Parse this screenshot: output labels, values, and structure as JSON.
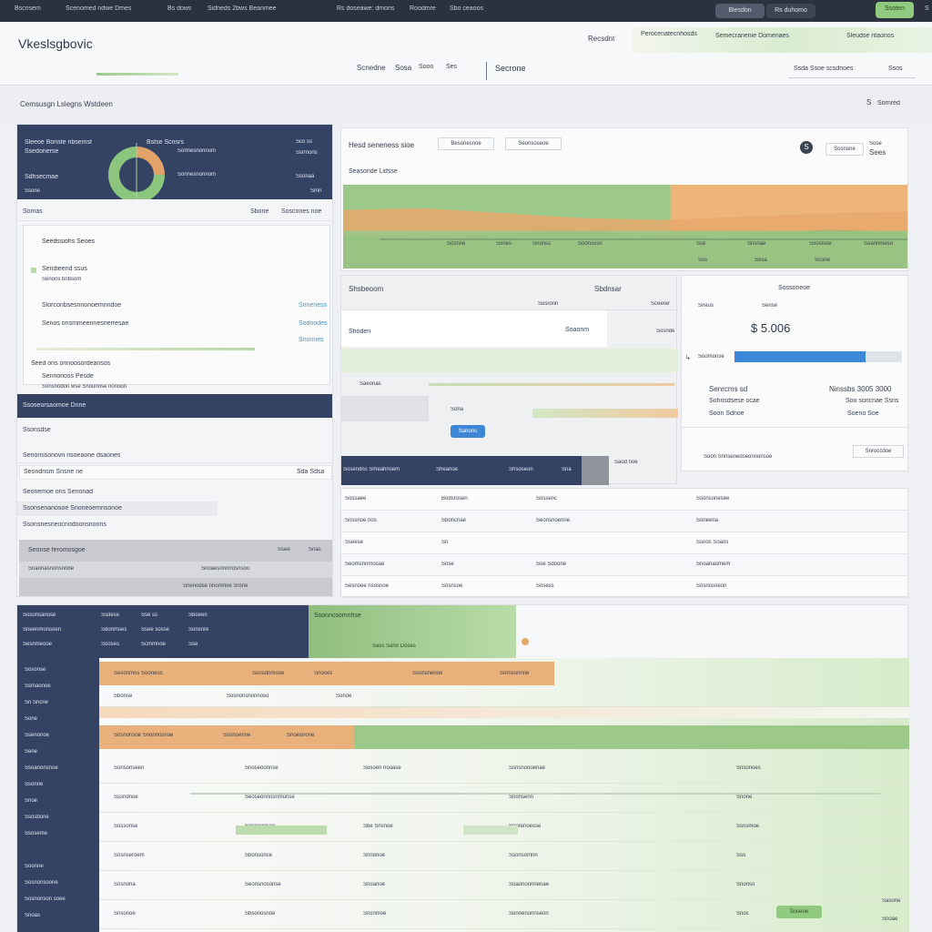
{
  "topbar": {
    "menu": [
      "Bscnsem",
      "Scenomed ndwe Dmes",
      "Bs dows",
      "Sidneds 2bws Beanmee",
      "Rs doseawe: dmons",
      "Roodmre",
      "Sbo ceaoos"
    ],
    "search_btn": "Blesdon",
    "filter_btn": "Rs duhomo",
    "action_btn": "Ssoten",
    "tail_icon": "S"
  },
  "header": {
    "title": "Vkeslsgbovic",
    "links": [
      "Recsdnt",
      "Perocenatecnhosds",
      "Semecranenie Domenaes",
      "Sleudse ntaonos"
    ],
    "tabs": [
      "Scnedne",
      "Sosa",
      "Sooo",
      "Ses"
    ],
    "active_tab": "Secrone",
    "right_tab": "Ssda Ssoe scsdnoes",
    "right_tab2": "Ssos"
  },
  "subnav": {
    "left": "Cemsusgn Lslegns Wstdeen",
    "right_icon": "S",
    "right": "Sornred"
  },
  "left_panel": {
    "navy_card": {
      "title": "Sleeoe Bonste nbsemst",
      "sub": "Ssedonerse",
      "label": "Sdhsecmae",
      "foot": "Ssone",
      "mid_title": "Bstse Scnsrs",
      "mid_sub": "Sorlnesnonnom",
      "right_a": "Sco ss",
      "right_b": "Ssrmons",
      "right_c": "Ssonaa",
      "right_d": "Smn"
    },
    "stat_row": {
      "left": "Somas",
      "mid": "Sbone",
      "right": "Soscones noe"
    },
    "section_title": "Seedssiohs Seoes",
    "items": [
      {
        "label": "Sendieend ssus",
        "value": ""
      },
      {
        "label": "Senons bnbsom",
        "value": ""
      },
      {
        "label": "Slorconbsesnnonoemnndoe",
        "value": "Snneness"
      },
      {
        "label": "Senos onsmmeennesnerresae",
        "value": "Sodnodes"
      },
      {
        "label": "",
        "value": "Snonnes"
      },
      {
        "label": "Seed ons onnoosordeansos",
        "value": ""
      },
      {
        "label": "Sennonoss Pesde",
        "value": ""
      },
      {
        "label": "Sonsnodon wse Snounnse nonoon",
        "value": ""
      }
    ],
    "navy_bar": "Ssoseorsaomoe Dnne",
    "list_title": "Ssonsdse",
    "list": [
      {
        "label": "Senonssonovn nsoeaone dsaones",
        "value": ""
      },
      {
        "label": "Seondnsm  Snsne ne",
        "value": "Sda Sdsa"
      },
      {
        "label": "Seonemoe ons Senonad",
        "value": ""
      },
      {
        "label": "Ssonsenanosoe Snoneoemnsonoe",
        "value": ""
      },
      {
        "label": "Ssonsnesneocnodoonsnoons",
        "value": ""
      }
    ],
    "grey_card": {
      "title": "Seonse feromosgoe",
      "a": "Ssee",
      "b": "Snas",
      "row": "Snaonasnonsnnbe",
      "row2": "Snoaesnnnnosnsoo",
      "row3": "Snenodse nnomnoe Srone"
    }
  },
  "chart_card": {
    "title": "Hesd seneness sioe",
    "tabs": [
      "Besonesnoe",
      "Seonsoseoe"
    ],
    "sub": "Seasonde Lidsse",
    "legend_icon": "S",
    "right_a": "Sosnone",
    "right_b": "Sose",
    "right_value": "Sees",
    "labels": [
      "Sosnne",
      "Sones",
      "Snonss",
      "Soonsosn"
    ],
    "right_labels": [
      "Sse",
      "Snsnae",
      "Sooslsoe",
      "Soannmeso"
    ],
    "foot": [
      "Sss",
      "Sosa",
      "Scone"
    ]
  },
  "chart_data": {
    "type": "area",
    "categories": [
      "Sosnne",
      "Sones",
      "Snonss",
      "Soonsosn",
      "Sse",
      "Snsnae",
      "Sooslsoe",
      "Soannmeso"
    ],
    "series": [
      {
        "name": "",
        "values": [
          70,
          72,
          66,
          60,
          58,
          62,
          66,
          68
        ]
      },
      {
        "name": "",
        "values": [
          40,
          38,
          42,
          44,
          40,
          42,
          46,
          44
        ]
      }
    ],
    "title": "Hesd seneness sioe",
    "xlabel": "",
    "ylabel": "",
    "grid": false,
    "legend": "none"
  },
  "mid_panel": {
    "title": "Shsbeoom",
    "right_title": "Sbdnsar",
    "col_a": "Sosronn",
    "col_b": "Sceerer",
    "rows": [
      "Shoden",
      "Soaonm",
      "Sosnde",
      "Saeonas",
      "Sona"
    ],
    "button": "Sanons",
    "navy_row": {
      "a": "Sosendns Smeahnsem",
      "b": "Sheanoe",
      "c": "Shsoseon",
      "d": "Sna"
    },
    "tail": "Saod noe"
  },
  "kpi_card": {
    "title": "Sossoneoe",
    "sub": "Sneus",
    "sub2": "Sense",
    "value": "$ 5.006",
    "progress_label": "Soomonse",
    "progress": 0.78,
    "row_a_l": "Senrcms sd",
    "row_a_r": "Ninssbs 3005 3000",
    "row_b_l": "Sohnsdsese ocae",
    "row_b_r": "Soo soncnae Ssns",
    "row_c_l": "Soon Sdnoe",
    "row_c_r": "Soeno Soe",
    "foot_a": "Soon Snnsenedseonnonsoe",
    "foot_b": "Snroccdoe"
  },
  "table_mid": {
    "rows": [
      [
        "Sossaee",
        "Bodsrosen",
        "Sossenc",
        "Ssonsonesee"
      ],
      [
        "Snssnoe nos",
        "Sboncnae",
        "Seonsnoenne",
        "Soneena"
      ],
      [
        "Sseese",
        "Sn",
        "",
        "Ssnos Soaos"
      ],
      [
        "Seomsnnmosae",
        "Sose",
        "Soe Sdoone",
        "Snoanaomem"
      ],
      [
        "Sesnoee nsosnoe",
        "Sosnsoe",
        "Sosess",
        "Sosnosoeon"
      ]
    ]
  },
  "bottom": {
    "navy_head": [
      [
        "Sosonsanose",
        "Ssdese",
        "Sse ss",
        "Sboeen"
      ],
      [
        "Sneenmonsoen",
        "Sdonmses",
        "Ssee sosse",
        "Sonsnre"
      ],
      [
        "Sesnmeooe",
        "Sooses",
        "Scmmnoe",
        "Sse"
      ]
    ],
    "green_title": "Ssonncsomnhse",
    "green_sub": "Sass Sano Doses",
    "sidebar": [
      "Sosonse",
      "Ssmaonoe",
      "Sn Sncne",
      "Sone",
      "Ssenonoe",
      "Sene",
      "Ssoanonsnoe",
      "Ssonrie",
      "Snoe",
      "Ssosbone",
      "Ssoseme",
      "",
      "Soonne",
      "Sosnonsoone",
      "Sosnonson soee",
      "Snoas"
    ],
    "orange_row_a": [
      "Sesonmos Sooneos",
      "Sonsdnmooe",
      "Snooes",
      "Ssonsnenoe",
      "Sornsonnne"
    ],
    "row_b": [
      "Sbonse",
      "Sosnonsnonnoso",
      "Sonoe"
    ],
    "orange_row_c": [
      "Sosnonsoe Snonnosnoe",
      "Ssonoenne",
      "Snoesnone"
    ],
    "rows": [
      [
        "Sonsonseen",
        "Snoseoonnse",
        "Sosoen nooase",
        "Ssnsnonoenae",
        "Snsonoes"
      ],
      [
        "Sssndnoe",
        "Seoseonnosnmonse",
        "",
        "Snonsenn",
        "Snone"
      ],
      [
        "Sossonse",
        "Sosnoonsoe",
        "Sbe Snsnoe",
        "Snorenoesse",
        "Ssnsmoe"
      ],
      [
        "Sosnseroem",
        "Sbonsonce",
        "Snnonoe",
        "Ssonsomnn",
        "Sso"
      ],
      [
        "Sosnona",
        "Seonsnosonse",
        "Snoanoe",
        "Soaononnnenae",
        "Snonso"
      ],
      [
        "Snsonoe",
        "Sbsonosnoe",
        "Sncnmoe",
        "Sonoenonnseon",
        "Snos"
      ]
    ],
    "green_btn": "Soseoe",
    "scroll_labels": [
      "Sasone",
      "Snoae"
    ]
  }
}
